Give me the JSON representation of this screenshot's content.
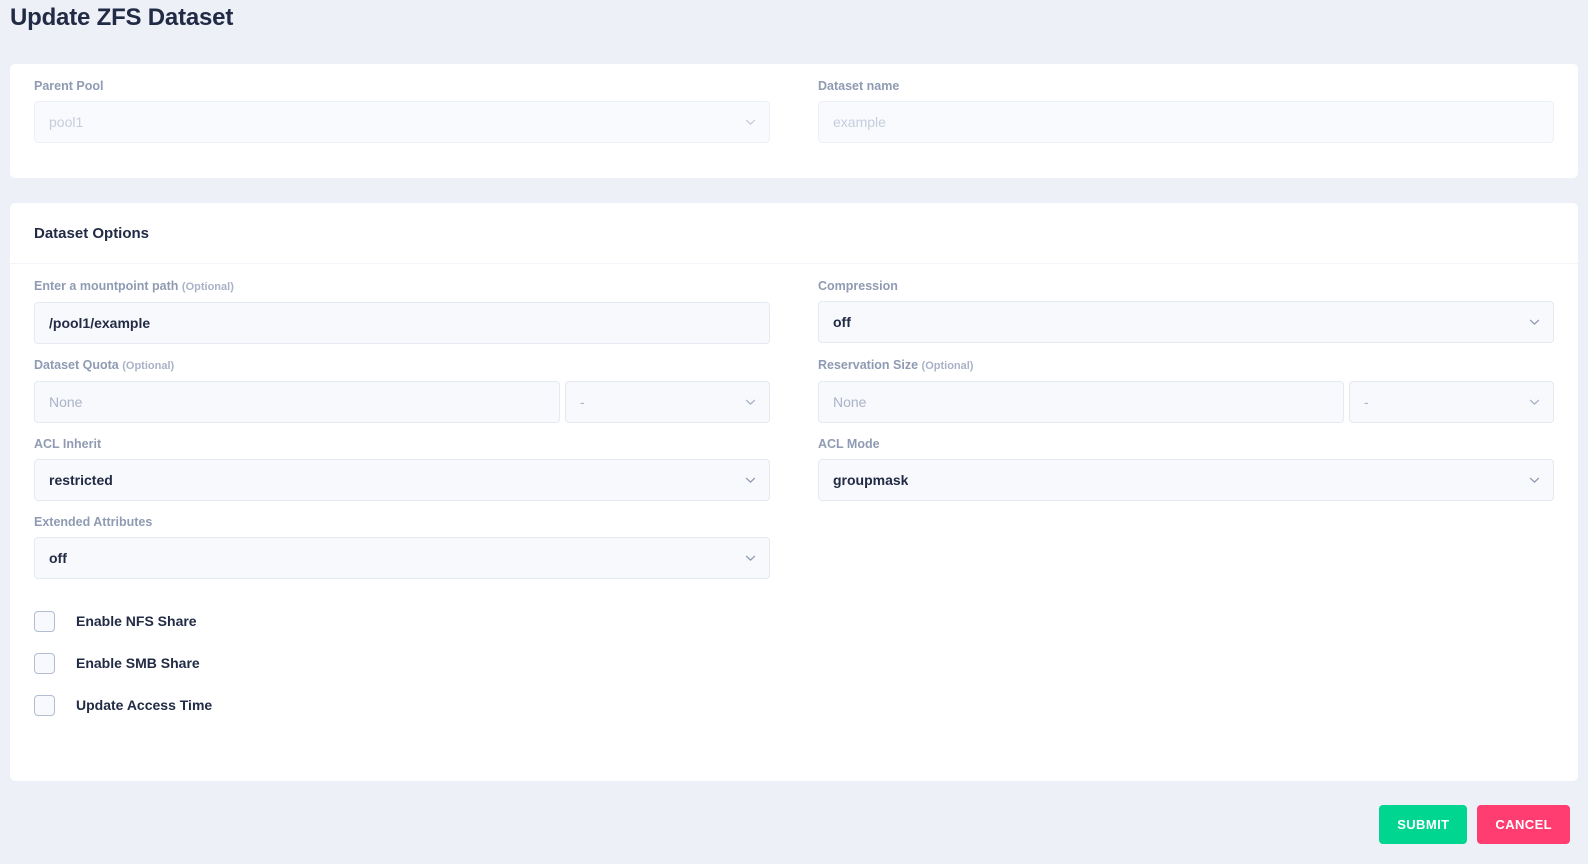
{
  "page": {
    "title": "Update ZFS Dataset"
  },
  "top_section": {
    "parent_pool": {
      "label": "Parent Pool",
      "value": "pool1",
      "icon": "chevron-down-icon"
    },
    "dataset_name": {
      "label": "Dataset name",
      "placeholder": "example",
      "value": ""
    }
  },
  "dataset_options": {
    "header": "Dataset Options",
    "mountpoint": {
      "label": "Enter a mountpoint path",
      "optional": "(Optional)",
      "value": "/pool1/example"
    },
    "compression": {
      "label": "Compression",
      "value": "off",
      "icon": "chevron-down-icon"
    },
    "quota": {
      "label": "Dataset Quota",
      "optional": "(Optional)",
      "placeholder": "None",
      "unit": "-",
      "icon": "chevron-down-icon"
    },
    "reservation": {
      "label": "Reservation Size",
      "optional": "(Optional)",
      "placeholder": "None",
      "unit": "-",
      "icon": "chevron-down-icon"
    },
    "acl_inherit": {
      "label": "ACL Inherit",
      "value": "restricted",
      "icon": "chevron-down-icon"
    },
    "acl_mode": {
      "label": "ACL Mode",
      "value": "groupmask",
      "icon": "chevron-down-icon"
    },
    "extended_attributes": {
      "label": "Extended Attributes",
      "value": "off",
      "icon": "chevron-down-icon"
    },
    "checkboxes": [
      {
        "label": "Enable NFS Share",
        "checked": false
      },
      {
        "label": "Enable SMB Share",
        "checked": false
      },
      {
        "label": "Update Access Time",
        "checked": false
      }
    ]
  },
  "footer": {
    "submit_label": "SUBMIT",
    "cancel_label": "CANCEL"
  },
  "colors": {
    "page_background": "#edf0f7",
    "card_background": "#ffffff",
    "text_primary": "#222b45",
    "text_muted": "#8f9bb3",
    "input_background": "#f7f9fc",
    "input_border": "#e4e9f2",
    "submit": "#00d68f",
    "cancel": "#ff3d71"
  }
}
